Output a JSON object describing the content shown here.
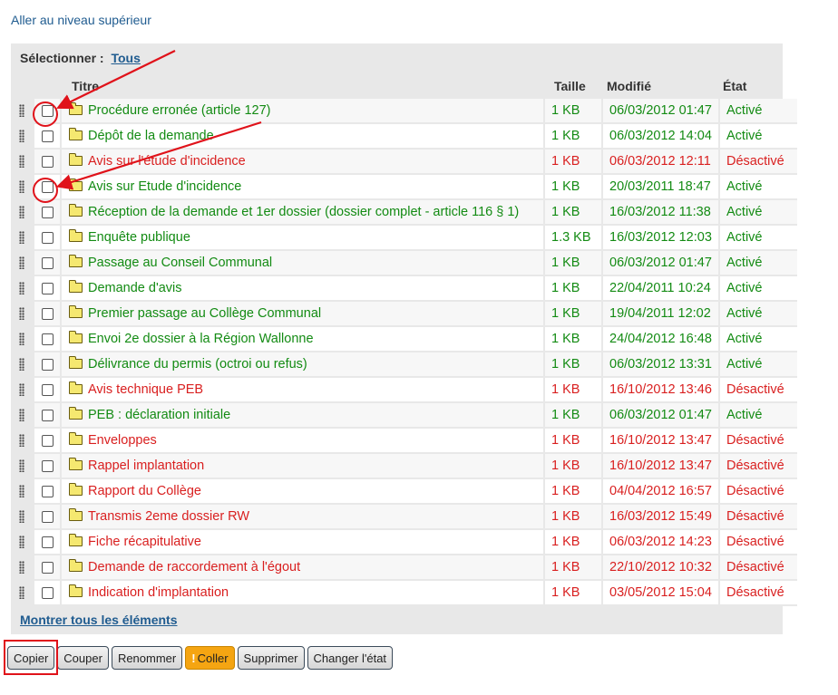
{
  "nav": {
    "up_label": "Aller au niveau supérieur"
  },
  "selection": {
    "label": "Sélectionner :",
    "all_link": "Tous"
  },
  "columns": {
    "title": "Titre",
    "size": "Taille",
    "modified": "Modifié",
    "state": "État"
  },
  "items": [
    {
      "title": "Procédure erronée (article 127)",
      "size": "1 KB",
      "modified": "06/03/2012 01:47",
      "state": "Activé",
      "active": true
    },
    {
      "title": "Dépôt de la demande",
      "size": "1 KB",
      "modified": "06/03/2012 14:04",
      "state": "Activé",
      "active": true
    },
    {
      "title": "Avis sur l'étude d'incidence",
      "size": "1 KB",
      "modified": "06/03/2012 12:11",
      "state": "Désactivé",
      "active": false
    },
    {
      "title": "Avis sur Etude d'incidence",
      "size": "1 KB",
      "modified": "20/03/2011 18:47",
      "state": "Activé",
      "active": true
    },
    {
      "title": "Réception de la demande et 1er dossier (dossier complet - article 116 § 1)",
      "size": "1 KB",
      "modified": "16/03/2012 11:38",
      "state": "Activé",
      "active": true
    },
    {
      "title": "Enquête publique",
      "size": "1.3 KB",
      "modified": "16/03/2012 12:03",
      "state": "Activé",
      "active": true
    },
    {
      "title": "Passage au Conseil Communal",
      "size": "1 KB",
      "modified": "06/03/2012 01:47",
      "state": "Activé",
      "active": true
    },
    {
      "title": "Demande d'avis",
      "size": "1 KB",
      "modified": "22/04/2011 10:24",
      "state": "Activé",
      "active": true
    },
    {
      "title": "Premier passage au Collège Communal",
      "size": "1 KB",
      "modified": "19/04/2011 12:02",
      "state": "Activé",
      "active": true
    },
    {
      "title": "Envoi 2e dossier à la Région Wallonne",
      "size": "1 KB",
      "modified": "24/04/2012 16:48",
      "state": "Activé",
      "active": true
    },
    {
      "title": "Délivrance du permis (octroi ou refus)",
      "size": "1 KB",
      "modified": "06/03/2012 13:31",
      "state": "Activé",
      "active": true
    },
    {
      "title": "Avis technique PEB",
      "size": "1 KB",
      "modified": "16/10/2012 13:46",
      "state": "Désactivé",
      "active": false
    },
    {
      "title": "PEB : déclaration initiale",
      "size": "1 KB",
      "modified": "06/03/2012 01:47",
      "state": "Activé",
      "active": true
    },
    {
      "title": "Enveloppes",
      "size": "1 KB",
      "modified": "16/10/2012 13:47",
      "state": "Désactivé",
      "active": false
    },
    {
      "title": "Rappel implantation",
      "size": "1 KB",
      "modified": "16/10/2012 13:47",
      "state": "Désactivé",
      "active": false
    },
    {
      "title": "Rapport du Collège",
      "size": "1 KB",
      "modified": "04/04/2012 16:57",
      "state": "Désactivé",
      "active": false
    },
    {
      "title": "Transmis 2eme dossier RW",
      "size": "1 KB",
      "modified": "16/03/2012 15:49",
      "state": "Désactivé",
      "active": false
    },
    {
      "title": "Fiche récapitulative",
      "size": "1 KB",
      "modified": "06/03/2012 14:23",
      "state": "Désactivé",
      "active": false
    },
    {
      "title": "Demande de raccordement à l'égout",
      "size": "1 KB",
      "modified": "22/10/2012 10:32",
      "state": "Désactivé",
      "active": false
    },
    {
      "title": "Indication d'implantation",
      "size": "1 KB",
      "modified": "03/05/2012 15:04",
      "state": "Désactivé",
      "active": false
    }
  ],
  "footer": {
    "show_all": "Montrer tous les éléments"
  },
  "buttons": {
    "copy": "Copier",
    "cut": "Couper",
    "rename": "Renommer",
    "paste_mark": "!",
    "paste": "Coller",
    "delete": "Supprimer",
    "change_state": "Changer l'état"
  },
  "colors": {
    "active": "#138b13",
    "inactive": "#d91f1f",
    "link": "#205c90",
    "annotation": "#e0121a",
    "paste_button": "#f5a512"
  }
}
